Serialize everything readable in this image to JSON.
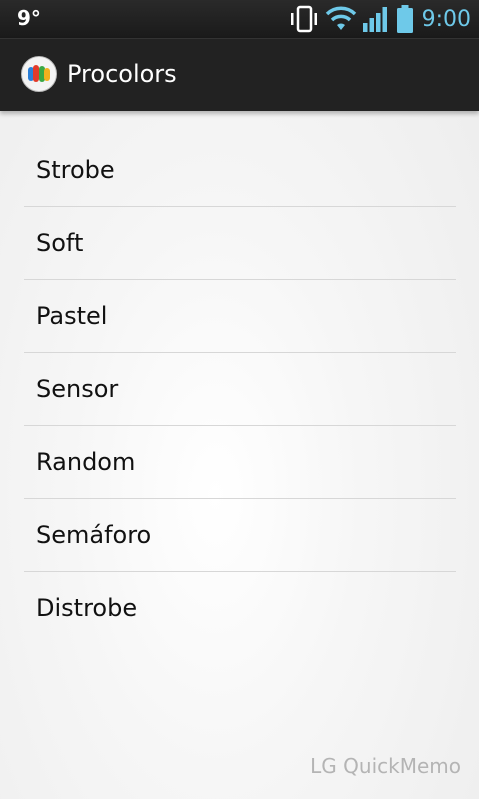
{
  "status_bar": {
    "temperature": "9°",
    "time": "9:00",
    "icons": [
      "vibrate-icon",
      "wifi-icon",
      "signal-icon",
      "battery-icon"
    ],
    "time_color": "#6ec9e9"
  },
  "action_bar": {
    "app_icon": "procolors-app-icon",
    "title": "Procolors"
  },
  "menu": {
    "items": [
      {
        "label": "Strobe"
      },
      {
        "label": "Soft"
      },
      {
        "label": "Pastel"
      },
      {
        "label": "Sensor"
      },
      {
        "label": "Random"
      },
      {
        "label": "Semáforo"
      },
      {
        "label": "Distrobe"
      }
    ]
  },
  "watermark": "LG QuickMemo"
}
